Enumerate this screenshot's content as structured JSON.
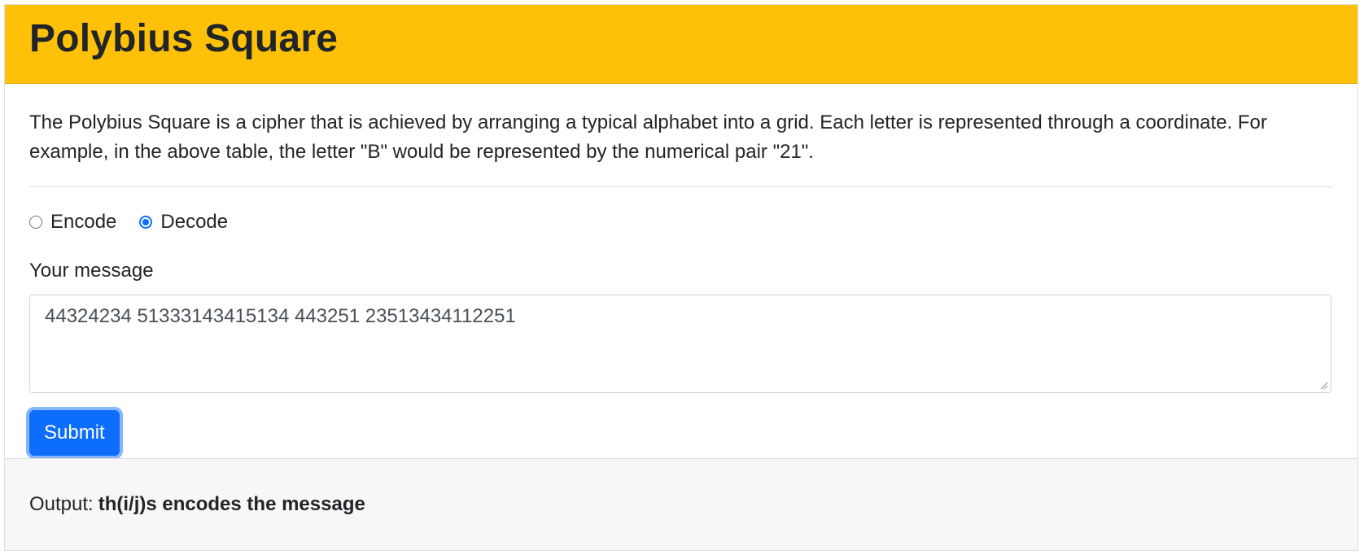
{
  "header": {
    "title": "Polybius Square"
  },
  "intro": {
    "text": "The Polybius Square is a cipher that is achieved by arranging a typical alphabet into a grid. Each letter is represented through a coordinate. For example, in the above table, the letter \"B\" would be represented by the numerical pair \"21\"."
  },
  "mode": {
    "options": [
      {
        "label": "Encode",
        "checked": false
      },
      {
        "label": "Decode",
        "checked": true
      }
    ]
  },
  "message": {
    "label": "Your message",
    "value": "44324234 51333143415134 443251 23513434112251"
  },
  "submit": {
    "label": "Submit"
  },
  "output": {
    "label": "Output:",
    "value": "th(i/j)s encodes the message"
  },
  "colors": {
    "header_bg": "#ffc107",
    "primary": "#0d6efd",
    "footer_bg": "#f7f7f7"
  }
}
